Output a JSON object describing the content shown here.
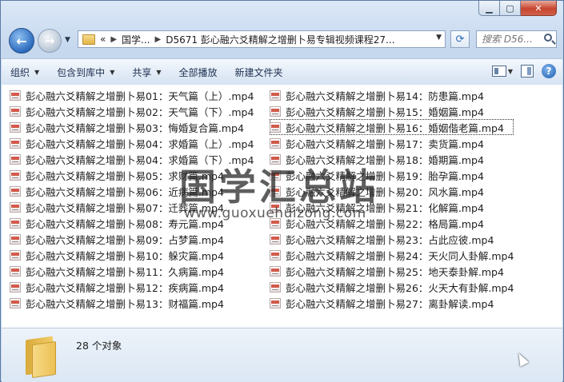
{
  "nav": {
    "crumbs": [
      "«",
      "国学...",
      "D5671 彭心融六爻精解之增删卜易专辑视频课程27..."
    ],
    "search_placeholder": "搜索 D56...",
    "back_icon": "back-arrow-icon",
    "forward_icon": "forward-arrow-icon"
  },
  "toolbar": {
    "organize": "组织",
    "include_in_library": "包含到库中",
    "share": "共享",
    "play_all": "全部播放",
    "new_folder": "新建文件夹"
  },
  "files": {
    "col1": [
      "彭心融六爻精解之增删卜易01：天气篇（上）.mp4",
      "彭心融六爻精解之增删卜易02：天气篇（下）.mp4",
      "彭心融六爻精解之增删卜易03：悔婚复合篇.mp4",
      "彭心融六爻精解之增删卜易04：求婚篇（上）.mp4",
      "彭心融六爻精解之增删卜易04：求婚篇（下）.mp4",
      "彭心融六爻精解之增删卜易05：求财篇.mp4",
      "彭心融六爻精解之增删卜易06：近病篇.mp4",
      "彭心融六爻精解之增删卜易07：迁葬篇.mp4",
      "彭心融六爻精解之增删卜易08：寿元篇.mp4",
      "彭心融六爻精解之增删卜易09：占梦篇.mp4",
      "彭心融六爻精解之增删卜易10：躲灾篇.mp4",
      "彭心融六爻精解之增删卜易11：久病篇.mp4",
      "彭心融六爻精解之增删卜易12：疾病篇.mp4",
      "彭心融六爻精解之增删卜易13：财福篇.mp4"
    ],
    "col2": [
      "彭心融六爻精解之增删卜易14：防患篇.mp4",
      "彭心融六爻精解之增删卜易15：婚姻篇.mp4",
      "彭心融六爻精解之增删卜易16：婚姻偕老篇.mp4",
      "彭心融六爻精解之增删卜易17：卖货篇.mp4",
      "彭心融六爻精解之增删卜易18：婚期篇.mp4",
      "彭心融六爻精解之增删卜易19：胎孕篇.mp4",
      "彭心融六爻精解之增删卜易20：风水篇.mp4",
      "彭心融六爻精解之增删卜易21：化解篇.mp4",
      "彭心融六爻精解之增删卜易22：格局篇.mp4",
      "彭心融六爻精解之增删卜易23：占此应彼.mp4",
      "彭心融六爻精解之增删卜易24：天火同人卦解.mp4",
      "彭心融六爻精解之增删卜易25：地天泰卦解.mp4",
      "彭心融六爻精解之增删卜易26：火天大有卦解.mp4",
      "彭心融六爻精解之增删卜易27：离卦解读.mp4"
    ]
  },
  "watermark": {
    "text": "国学汇总站",
    "url": "www.guoxuehuizong.com"
  },
  "details": {
    "count": "28 个对象"
  }
}
